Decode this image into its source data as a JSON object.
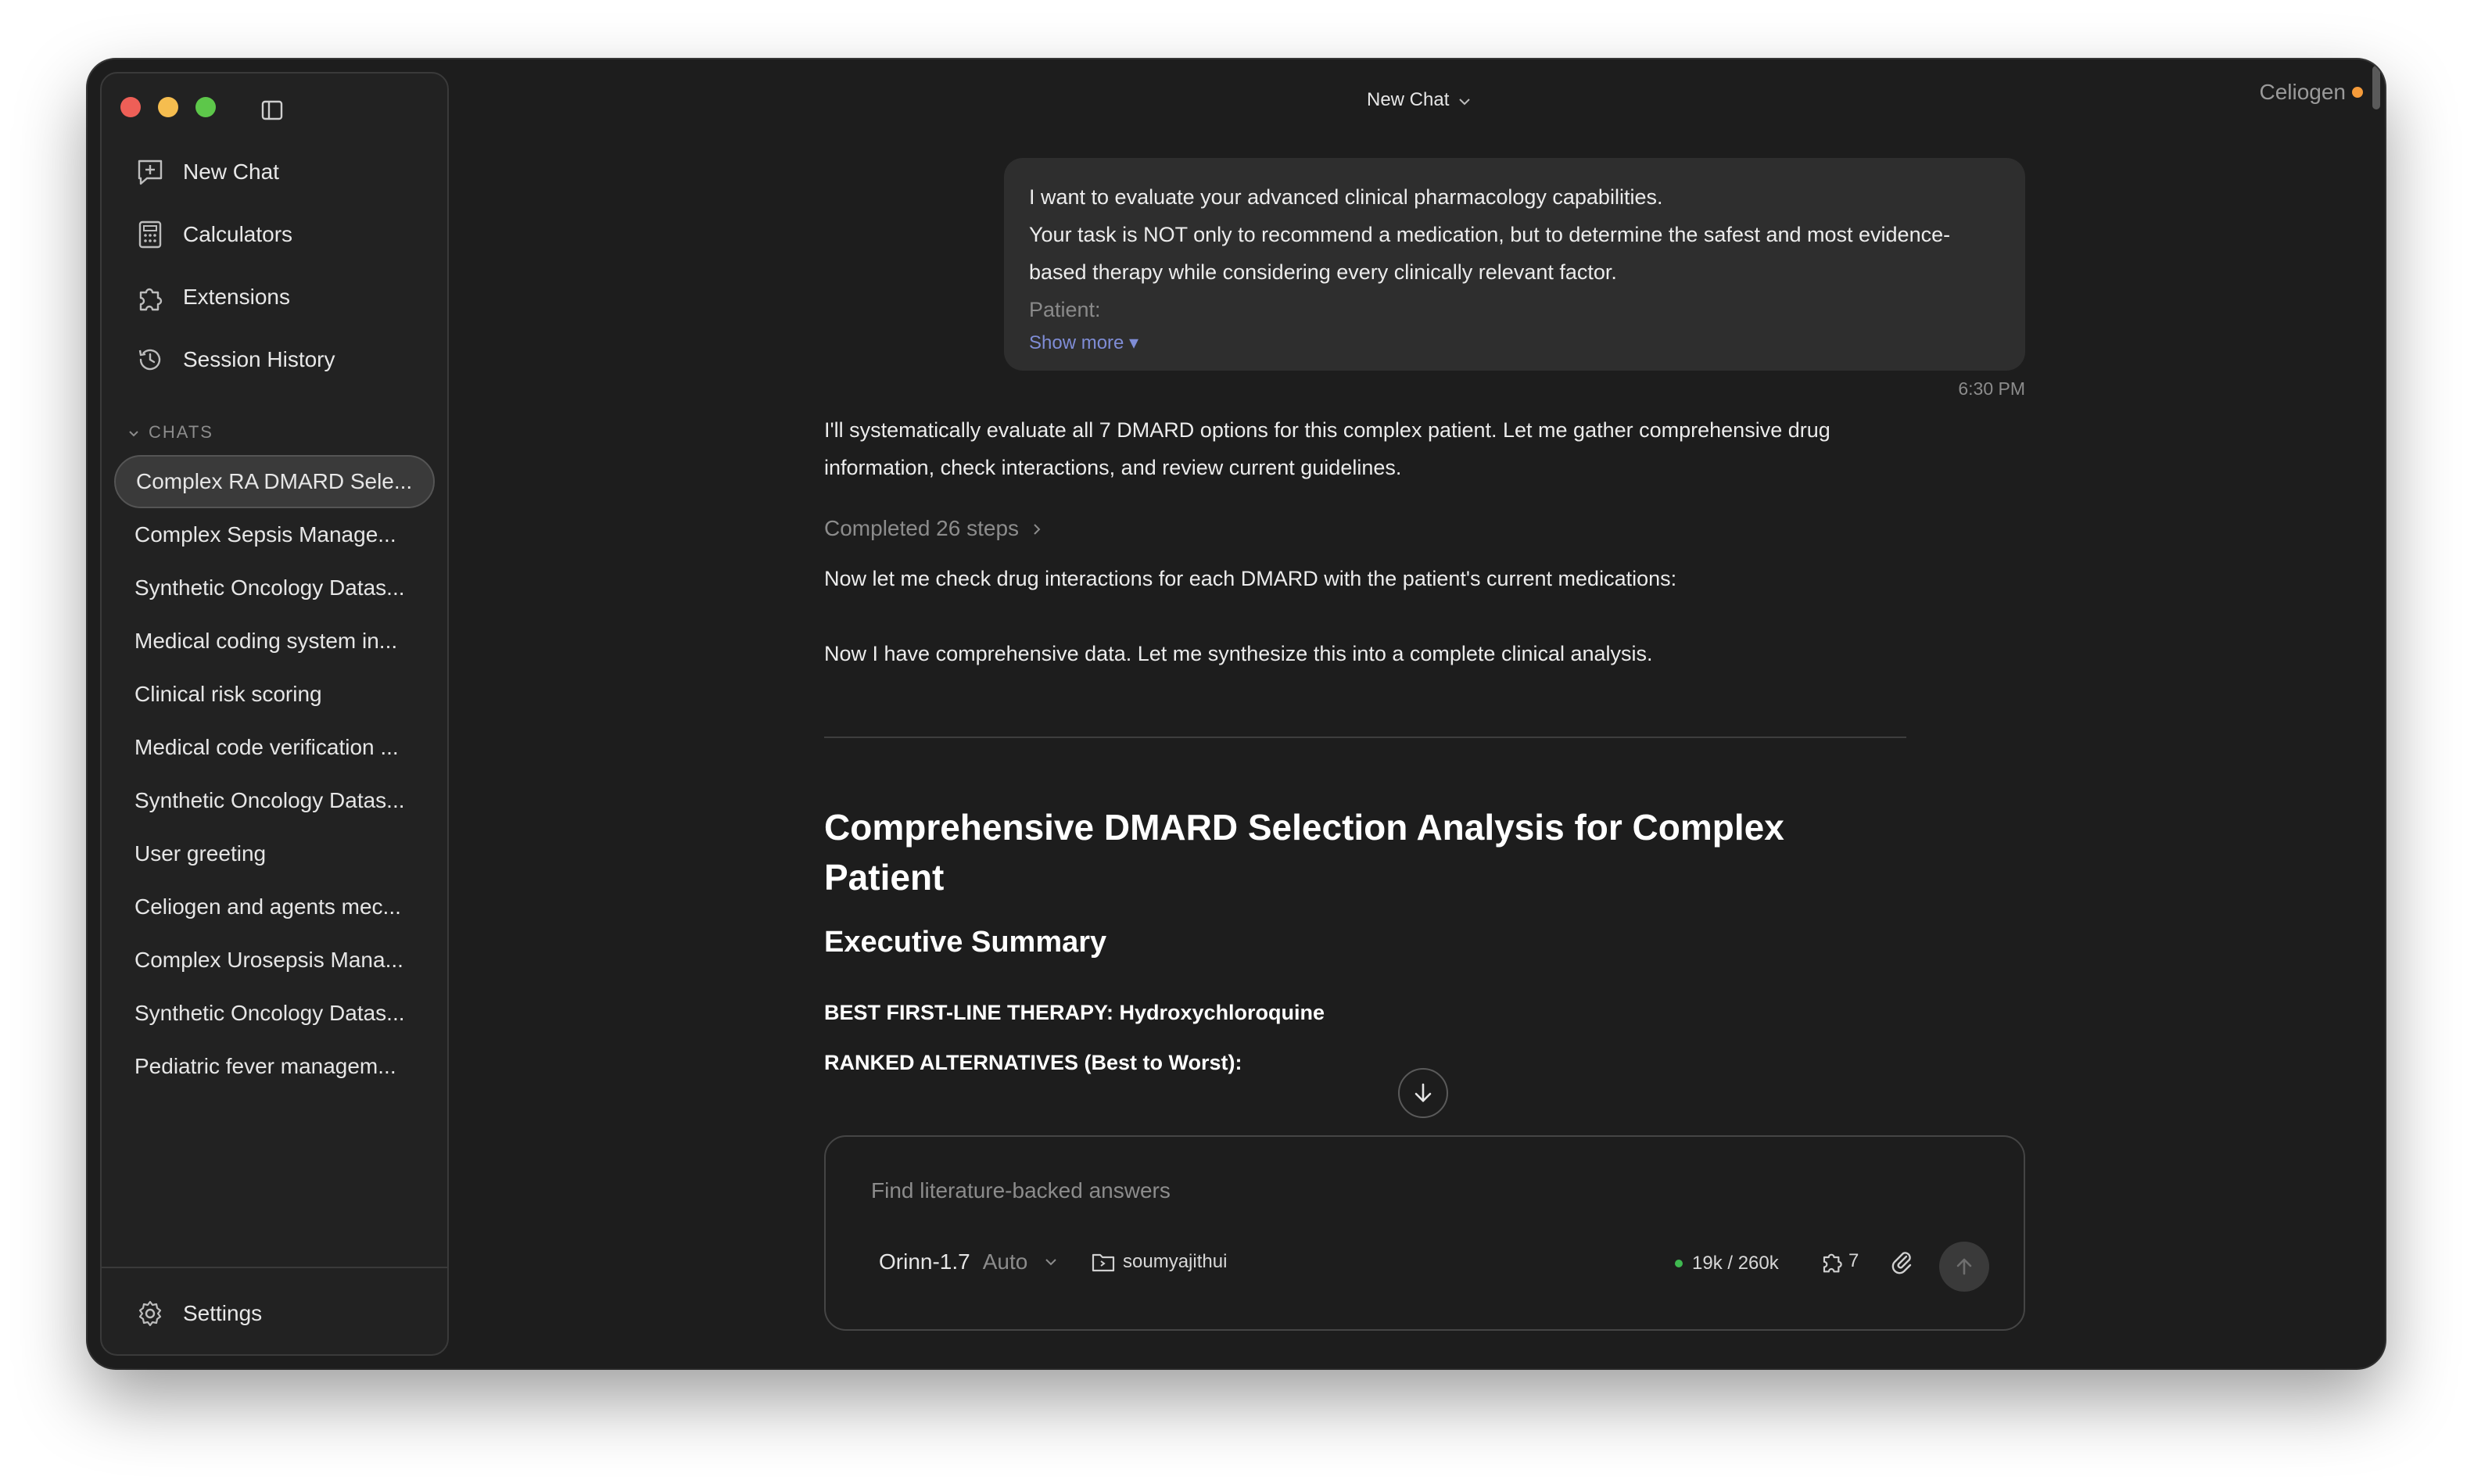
{
  "window": {
    "title": "New Chat",
    "brand": "Celiogen"
  },
  "sidebar": {
    "nav": [
      {
        "label": "New Chat",
        "icon": "new-chat-icon"
      },
      {
        "label": "Calculators",
        "icon": "calculator-icon"
      },
      {
        "label": "Extensions",
        "icon": "puzzle-icon"
      },
      {
        "label": "Session History",
        "icon": "history-icon"
      }
    ],
    "chats_header": "CHATS",
    "chats": [
      "Complex RA DMARD Sele...",
      "Complex Sepsis Manage...",
      "Synthetic Oncology Datas...",
      "Medical coding system in...",
      "Clinical risk scoring",
      "Medical code verification ...",
      "Synthetic Oncology Datas...",
      "User greeting",
      "Celiogen and agents mec...",
      "Complex Urosepsis Mana...",
      "Synthetic Oncology Datas...",
      "Pediatric fever managem..."
    ],
    "active_chat_index": 0,
    "settings_label": "Settings"
  },
  "conversation": {
    "user_message": {
      "lines": [
        "I want to evaluate your advanced clinical pharmacology capabilities.",
        "Your task is NOT only to recommend a medication, but to determine the safest and most evidence-",
        "based therapy while considering every clinically relevant factor.",
        "Patient:"
      ],
      "show_more": "Show more ▾",
      "time": "6:30 PM"
    },
    "assistant": {
      "intro_line1": "I'll systematically evaluate all 7 DMARD options for this complex patient. Let me gather comprehensive drug",
      "intro_line2": "information, check interactions, and review current guidelines.",
      "completed_steps": "Completed 26 steps",
      "line_interactions": "Now let me check drug interactions for each DMARD with the patient's current medications:",
      "line_synthesize": "Now I have comprehensive data. Let me synthesize this into a complete clinical analysis.",
      "heading": "Comprehensive DMARD Selection Analysis for Complex Patient",
      "subheading": "Executive Summary",
      "best_therapy": "BEST FIRST-LINE THERAPY: Hydroxychloroquine",
      "ranked_alternatives": "RANKED ALTERNATIVES (Best to Worst):"
    }
  },
  "composer": {
    "placeholder": "Find literature-backed answers",
    "model": "Orinn-1.7",
    "model_mode": "Auto",
    "folder": "soumyajithui",
    "tokens": "19k / 260k",
    "extensions_count": "7"
  },
  "colors": {
    "background": "#1d1d1d",
    "sidebar": "#222222",
    "bubble": "#2e2e2e",
    "accent_link": "#7f8dd6",
    "status_green": "#3fb950",
    "brand_dot": "#f59b3a"
  }
}
